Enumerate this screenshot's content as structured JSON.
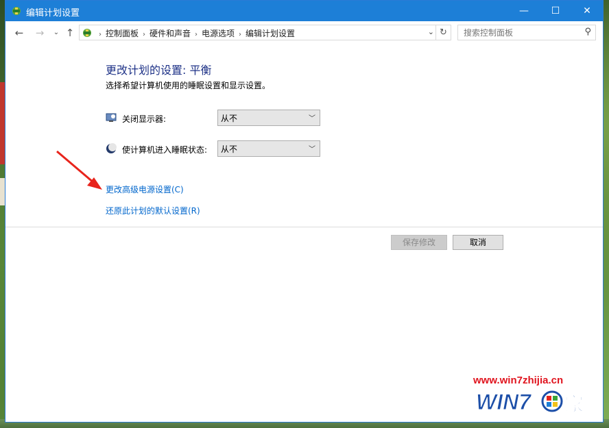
{
  "window": {
    "title": "编辑计划设置",
    "controls": {
      "minimize": "—",
      "maximize": "☐",
      "close": "✕"
    }
  },
  "nav": {
    "back": "←",
    "forward": "→",
    "recent": "⌄",
    "up": "↑",
    "breadcrumbs": [
      "控制面板",
      "硬件和声音",
      "电源选项",
      "编辑计划设置"
    ],
    "separator": "›",
    "dropdown": "⌄",
    "refresh": "↻",
    "search_placeholder": "搜索控制面板",
    "search_glyph": "⚲"
  },
  "content": {
    "title": "更改计划的设置: 平衡",
    "subtitle": "选择希望计算机使用的睡眠设置和显示设置。",
    "settings": [
      {
        "label": "关闭显示器:",
        "value": "从不",
        "icon": "monitor-icon"
      },
      {
        "label": "使计算机进入睡眠状态:",
        "value": "从不",
        "icon": "moon-icon"
      }
    ],
    "select_arrow": "﹀",
    "links": [
      "更改高级电源设置(C)",
      "还原此计划的默认设置(R)"
    ],
    "buttons": {
      "save": "保存修改",
      "cancel": "取消"
    }
  },
  "watermark": {
    "url": "www.win7zhijia.cn",
    "logo_text": "WIN7"
  },
  "colors": {
    "titlebar": "#1d7fd7",
    "link": "#0066cc",
    "title_text": "#1e3287",
    "arrow": "#e8241c"
  }
}
